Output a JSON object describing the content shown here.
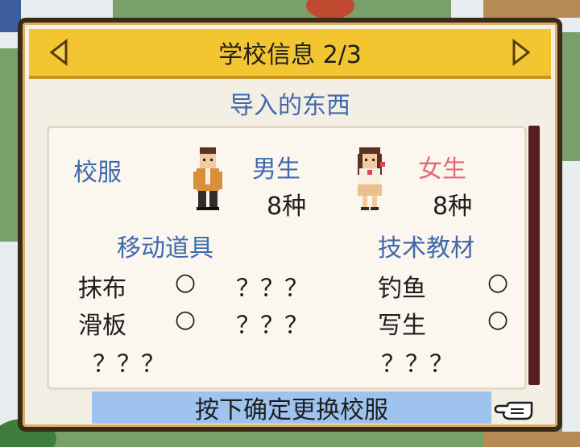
{
  "dialog": {
    "title": "学校信息 2/3",
    "subtitle": "导入的东西",
    "prev_icon": "triangle-left-icon",
    "next_icon": "triangle-right-icon"
  },
  "uniform": {
    "label": "校服",
    "male": {
      "label": "男生",
      "count": "8种"
    },
    "female": {
      "label": "女生",
      "count": "8种"
    }
  },
  "items": {
    "header": "移动道具",
    "rows": [
      {
        "name": "抹布",
        "mark": "○",
        "unknown": "？？？"
      },
      {
        "name": "滑板",
        "mark": "○",
        "unknown": "？？？"
      }
    ],
    "more": "？？？"
  },
  "materials": {
    "header": "技术教材",
    "rows": [
      {
        "name": "钓鱼",
        "mark": "○"
      },
      {
        "name": "写生",
        "mark": "○"
      }
    ],
    "more": "？？？"
  },
  "footer": {
    "confirm_label": "按下确定更换校服",
    "pointer_icon": "pointing-hand-icon"
  },
  "colors": {
    "titlebar": "#f3c631",
    "accent_blue": "#3e6aab",
    "accent_pink": "#e36a7a",
    "confirm_bg": "#9ec3ee",
    "scrollbar": "#5a1e20"
  }
}
